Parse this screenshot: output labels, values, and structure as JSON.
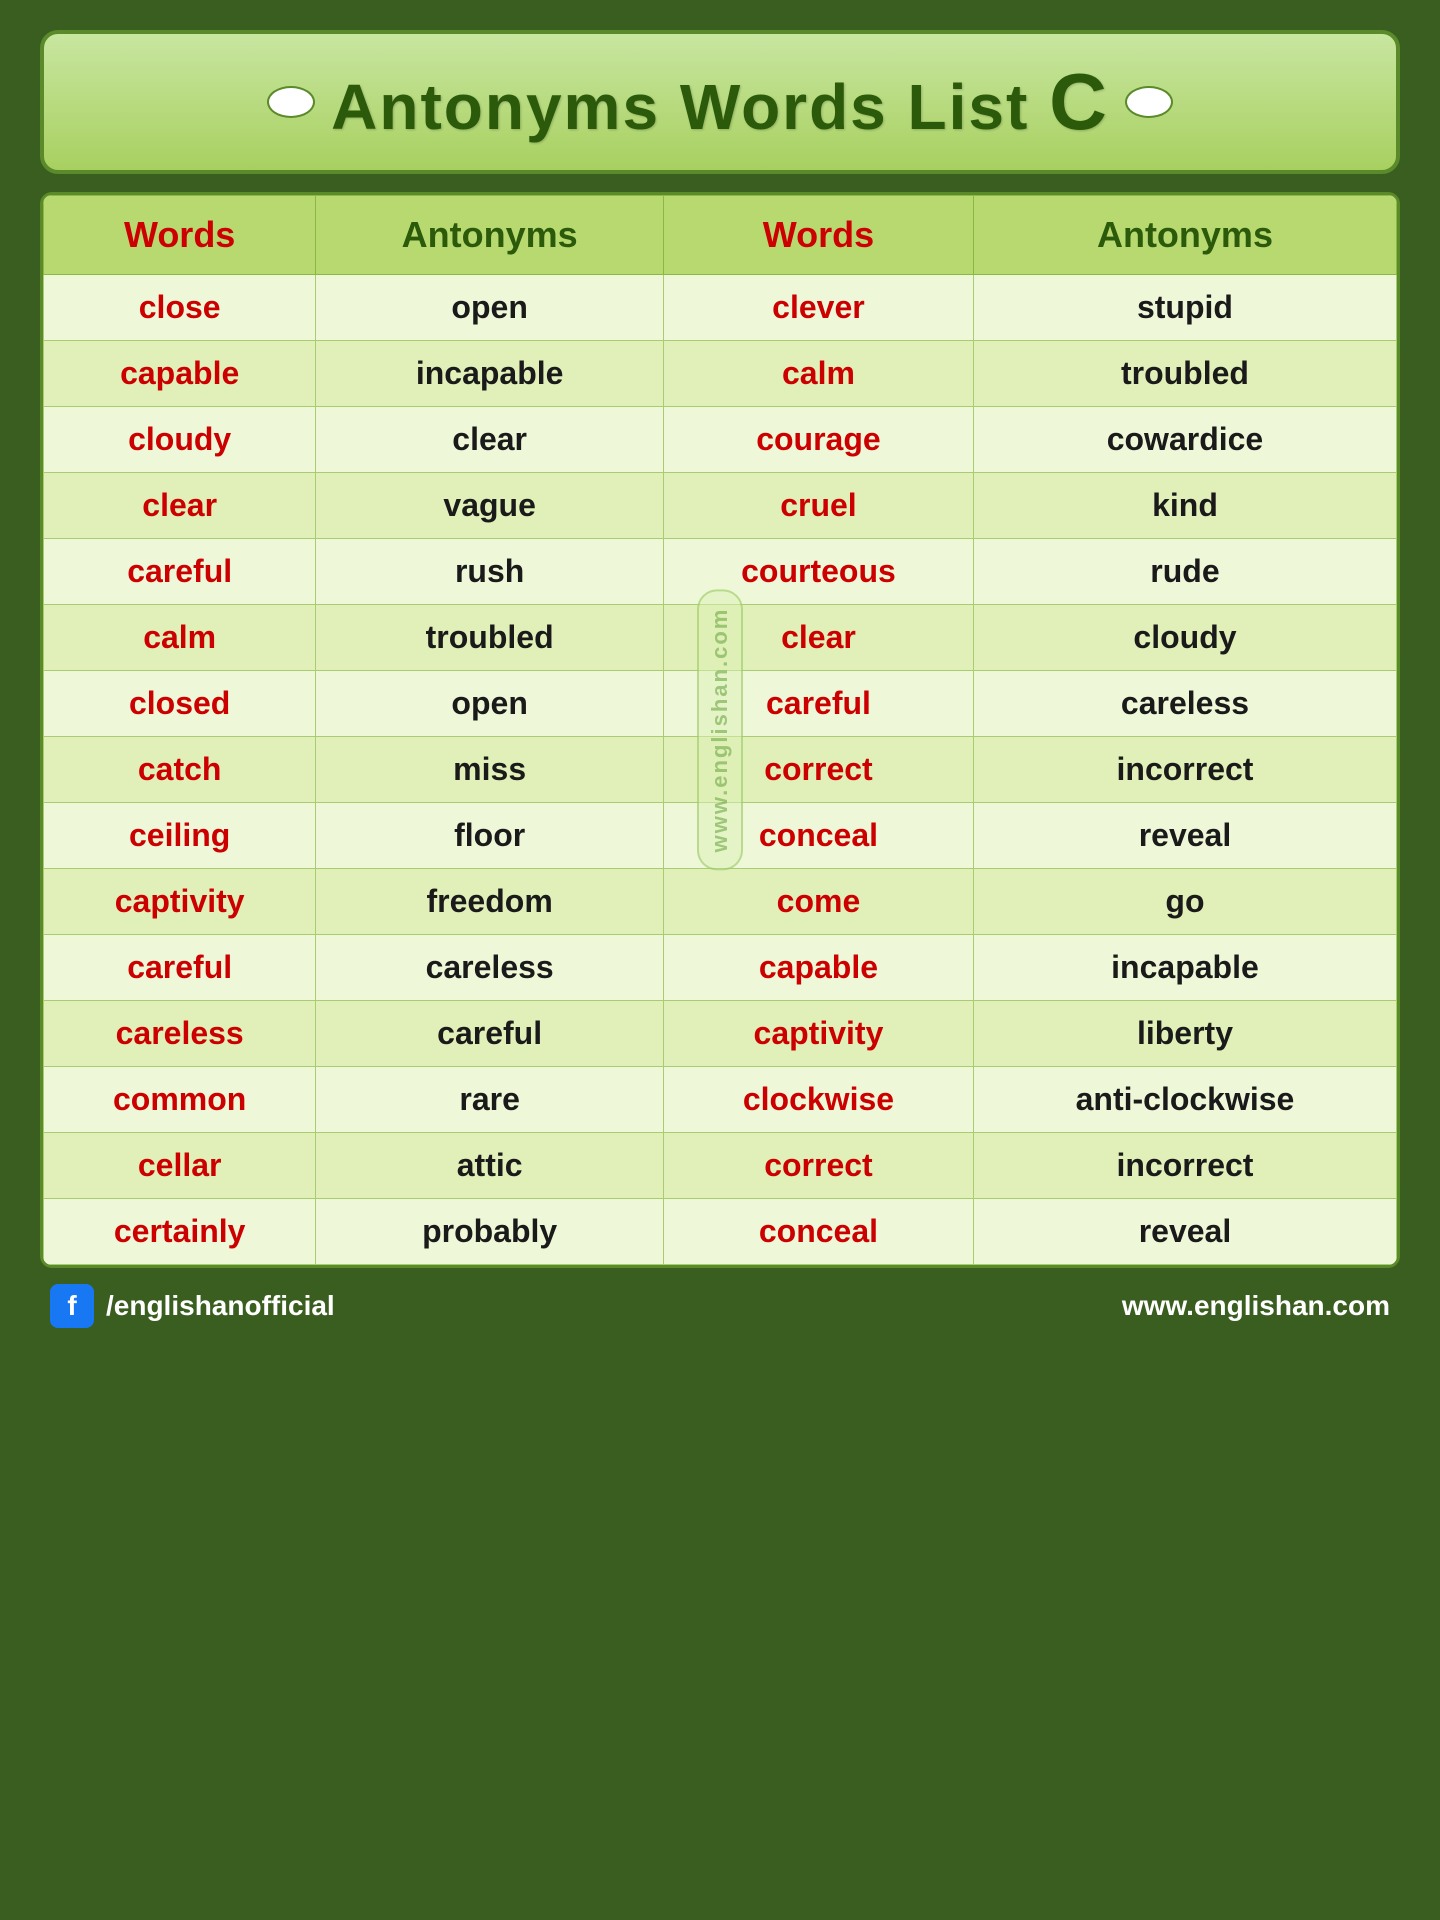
{
  "title": {
    "text": "Antonyms Words  List ",
    "letter": "C",
    "full": "Antonyms Words List C"
  },
  "header": {
    "col1": "Words",
    "col2": "Antonyms",
    "col3": "Words",
    "col4": "Antonyms"
  },
  "rows": [
    {
      "w1": "close",
      "a1": "open",
      "w2": "clever",
      "a2": "stupid"
    },
    {
      "w1": "capable",
      "a1": "incapable",
      "w2": "calm",
      "a2": "troubled"
    },
    {
      "w1": "cloudy",
      "a1": "clear",
      "w2": "courage",
      "a2": "cowardice"
    },
    {
      "w1": "clear",
      "a1": "vague",
      "w2": "cruel",
      "a2": "kind"
    },
    {
      "w1": "careful",
      "a1": "rush",
      "w2": "courteous",
      "a2": "rude"
    },
    {
      "w1": "calm",
      "a1": "troubled",
      "w2": "clear",
      "a2": "cloudy"
    },
    {
      "w1": "closed",
      "a1": "open",
      "w2": "careful",
      "a2": "careless"
    },
    {
      "w1": "catch",
      "a1": "miss",
      "w2": "correct",
      "a2": "incorrect"
    },
    {
      "w1": "ceiling",
      "a1": "floor",
      "w2": "conceal",
      "a2": "reveal"
    },
    {
      "w1": "captivity",
      "a1": "freedom",
      "w2": "come",
      "a2": "go"
    },
    {
      "w1": "careful",
      "a1": "careless",
      "w2": "capable",
      "a2": "incapable"
    },
    {
      "w1": "careless",
      "a1": "careful",
      "w2": "captivity",
      "a2": "liberty"
    },
    {
      "w1": "common",
      "a1": "rare",
      "w2": "clockwise",
      "a2": "anti-clockwise"
    },
    {
      "w1": "cellar",
      "a1": "attic",
      "w2": "correct",
      "a2": "incorrect"
    },
    {
      "w1": "certainly",
      "a1": "probably",
      "w2": "conceal",
      "a2": "reveal"
    }
  ],
  "watermark": "www.englishan.com",
  "footer": {
    "fb_handle": "/englishanofficial",
    "website": "www.englishan.com"
  }
}
